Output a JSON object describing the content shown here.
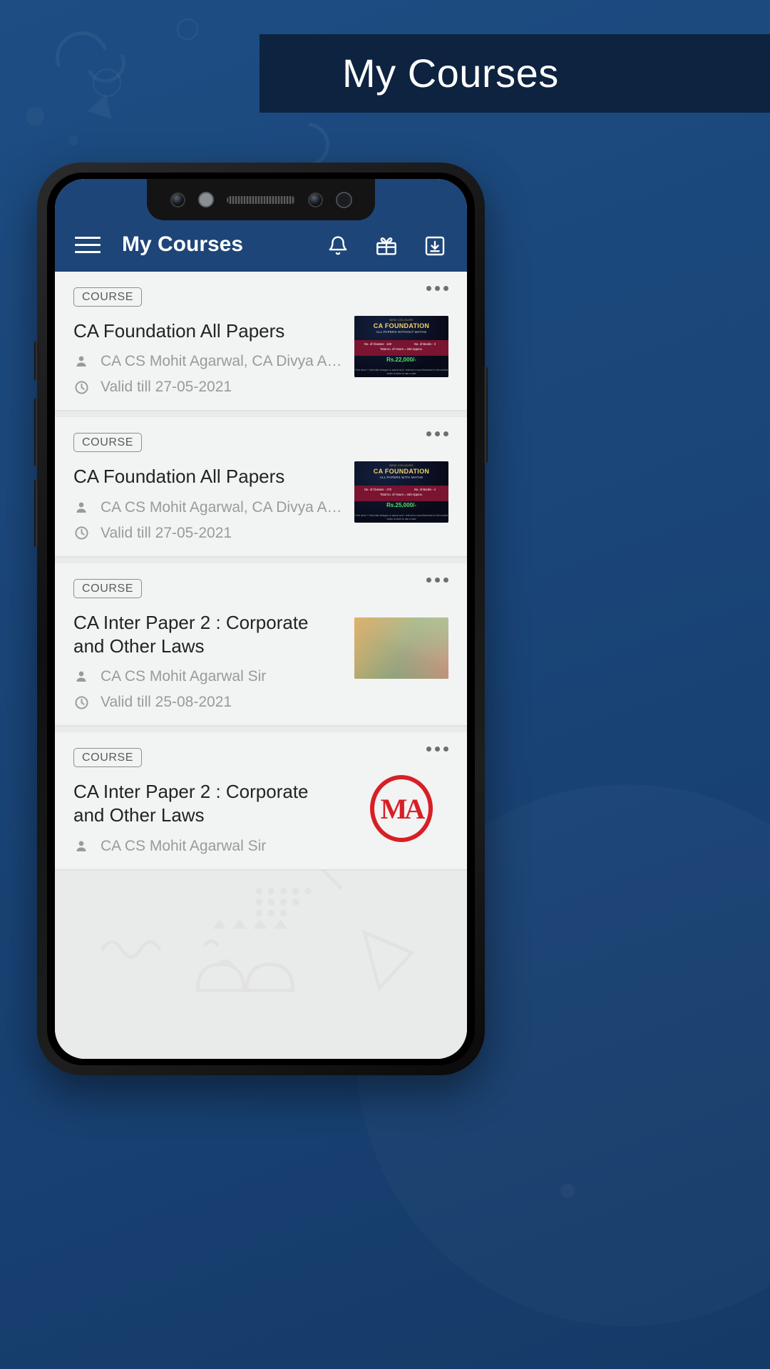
{
  "banner": {
    "title": "My Courses"
  },
  "colors": {
    "background": "#1d4d83",
    "banner_bg": "#0d2340",
    "appbar_bg": "#1d4578",
    "card_bg": "#f2f3f3",
    "list_bg": "#e9eaea",
    "badge_border": "#8d8d8d",
    "meta_text": "#9a9a9a",
    "title_text": "#232323",
    "logo_red": "#d81f26",
    "price_green": "#56e06a"
  },
  "appbar": {
    "title": "My Courses",
    "menu_icon": "hamburger-menu-icon",
    "actions": [
      {
        "name": "notifications-icon",
        "label": "Notifications"
      },
      {
        "name": "gift-icon",
        "label": "Offers"
      },
      {
        "name": "downloads-icon",
        "label": "Downloads"
      }
    ]
  },
  "courses": [
    {
      "badge": "COURSE",
      "title": "CA Foundation All Papers",
      "instructor": "CA CS Mohit Agarwal, CA Divya Agarwal...",
      "validity": "Valid till 27-05-2021",
      "instructor_icon": "person-icon",
      "validity_icon": "clock-icon",
      "overflow_icon": "more-options-icon",
      "thumbnail": {
        "type": "poster",
        "kicker": "NEW COLOURS",
        "title": "CA FOUNDATION",
        "subtitle": "ALL PAPERS WITHOUT MATHS",
        "stat_left": "No. of Classes - 129",
        "stat_right": "No. of Books - 3",
        "stat_bottom": "Total no. of Hours = 340 Approx.",
        "price": "Rs.22,000/-",
        "footer": "+Fee drive + Hard disk charges or actual cost / referral or kaxa\nMaximum to the models which is done to use a care"
      }
    },
    {
      "badge": "COURSE",
      "title": "CA Foundation All Papers",
      "instructor": "CA CS Mohit Agarwal, CA Divya Agarwal...",
      "validity": "Valid till 27-05-2021",
      "instructor_icon": "person-icon",
      "validity_icon": "clock-icon",
      "overflow_icon": "more-options-icon",
      "thumbnail": {
        "type": "poster",
        "kicker": "NEW COLOURS",
        "title": "CA FOUNDATION",
        "subtitle": "ALL PAPERS WITH MATHS",
        "stat_left": "No. of Classes - 170",
        "stat_right": "No. of Books - 4",
        "stat_bottom": "Total no. of Hours = 340 Approx.",
        "price": "Rs.25,000/-",
        "footer": "+Fee drive + Hard disk charges or actual cost / referral or kaxa\nMaximum to the models which is done to use a care"
      }
    },
    {
      "badge": "COURSE",
      "title": "CA Inter Paper 2 : Corporate and Other Laws",
      "instructor": "CA CS Mohit Agarwal Sir",
      "validity": "Valid till 25-08-2021",
      "instructor_icon": "person-icon",
      "validity_icon": "clock-icon",
      "overflow_icon": "more-options-icon",
      "thumbnail": {
        "type": "polygon"
      }
    },
    {
      "badge": "COURSE",
      "title": "CA Inter Paper 2 : Corporate and Other Laws",
      "instructor": "CA CS Mohit Agarwal Sir",
      "validity": "",
      "instructor_icon": "person-icon",
      "validity_icon": "clock-icon",
      "overflow_icon": "more-options-icon",
      "thumbnail": {
        "type": "logo",
        "logo_text": "MA"
      }
    }
  ]
}
